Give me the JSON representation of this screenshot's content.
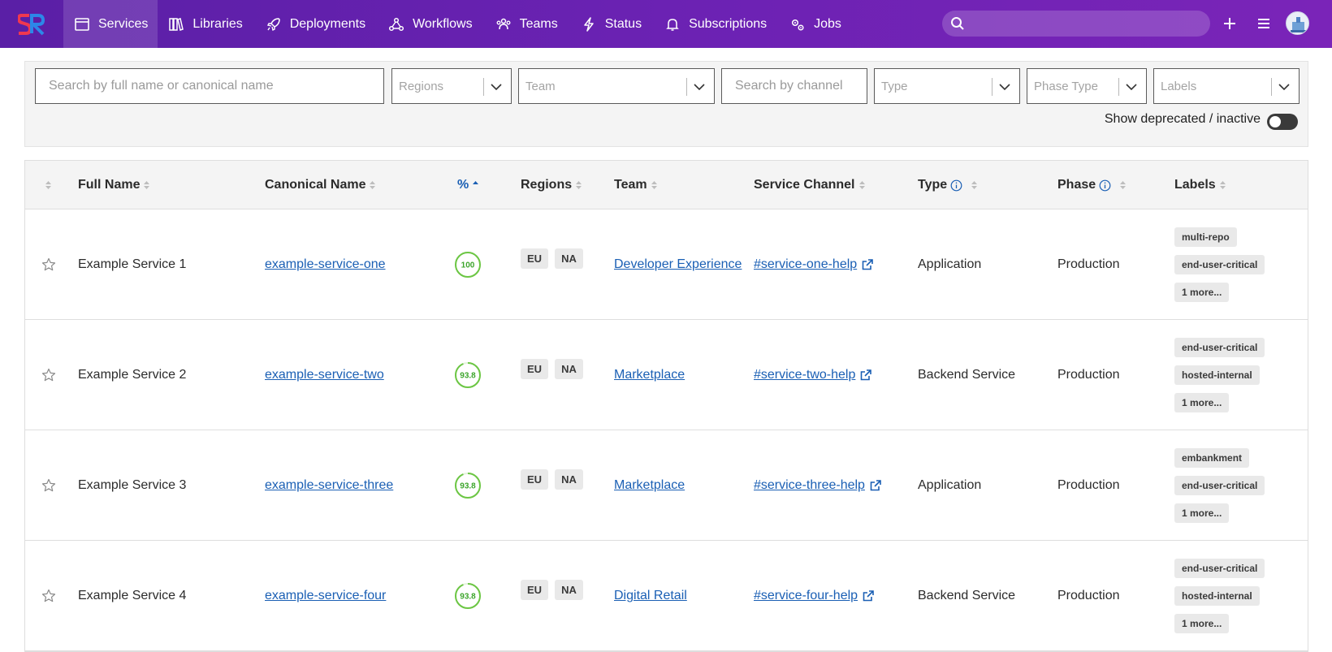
{
  "nav": {
    "items": [
      {
        "label": "Services",
        "icon": "calendar-window-icon",
        "active": true
      },
      {
        "label": "Libraries",
        "icon": "books-icon"
      },
      {
        "label": "Deployments",
        "icon": "rocket-icon"
      },
      {
        "label": "Workflows",
        "icon": "workflow-icon"
      },
      {
        "label": "Teams",
        "icon": "team-icon"
      },
      {
        "label": "Status",
        "icon": "lightning-icon"
      },
      {
        "label": "Subscriptions",
        "icon": "bell-icon"
      },
      {
        "label": "Jobs",
        "icon": "gears-icon"
      }
    ],
    "search_placeholder": ""
  },
  "filters": {
    "search_name_placeholder": "Search by full name or canonical name",
    "regions_placeholder": "Regions",
    "team_placeholder": "Team",
    "channel_placeholder": "Search by channel",
    "type_placeholder": "Type",
    "phase_type_placeholder": "Phase Type",
    "labels_placeholder": "Labels",
    "show_deprecated_label": "Show deprecated / inactive"
  },
  "table": {
    "headers": {
      "full_name": "Full Name",
      "canonical_name": "Canonical Name",
      "pct": "%",
      "regions": "Regions",
      "team": "Team",
      "service_channel": "Service Channel",
      "type": "Type",
      "phase": "Phase",
      "labels": "Labels"
    },
    "rows": [
      {
        "full_name": "Example Service 1",
        "canonical_name": "example-service-one",
        "pct": "100",
        "pct_value": 100,
        "regions": [
          "EU",
          "NA"
        ],
        "team": "Developer Experience",
        "channel": "#service-one-help",
        "type": "Application",
        "phase": "Production",
        "labels": [
          "multi-repo",
          "end-user-critical",
          "1 more..."
        ]
      },
      {
        "full_name": "Example Service 2",
        "canonical_name": "example-service-two",
        "pct": "93.8",
        "pct_value": 93.8,
        "regions": [
          "EU",
          "NA"
        ],
        "team": "Marketplace",
        "channel": "#service-two-help",
        "type": "Backend Service",
        "phase": "Production",
        "labels": [
          "end-user-critical",
          "hosted-internal",
          "1 more..."
        ]
      },
      {
        "full_name": "Example Service 3",
        "canonical_name": "example-service-three",
        "pct": "93.8",
        "pct_value": 93.8,
        "regions": [
          "EU",
          "NA"
        ],
        "team": "Marketplace",
        "channel": "#service-three-help",
        "type": "Application",
        "phase": "Production",
        "labels": [
          "embankment",
          "end-user-critical",
          "1 more..."
        ]
      },
      {
        "full_name": "Example Service 4",
        "canonical_name": "example-service-four",
        "pct": "93.8",
        "pct_value": 93.8,
        "regions": [
          "EU",
          "NA"
        ],
        "team": "Digital Retail",
        "channel": "#service-four-help",
        "type": "Backend Service",
        "phase": "Production",
        "labels": [
          "end-user-critical",
          "hosted-internal",
          "1 more..."
        ]
      }
    ]
  },
  "colors": {
    "nav_start": "#5a1fa6",
    "nav_end": "#7a24b8",
    "link": "#1a5fb4",
    "score_ring": "#6cc644"
  }
}
